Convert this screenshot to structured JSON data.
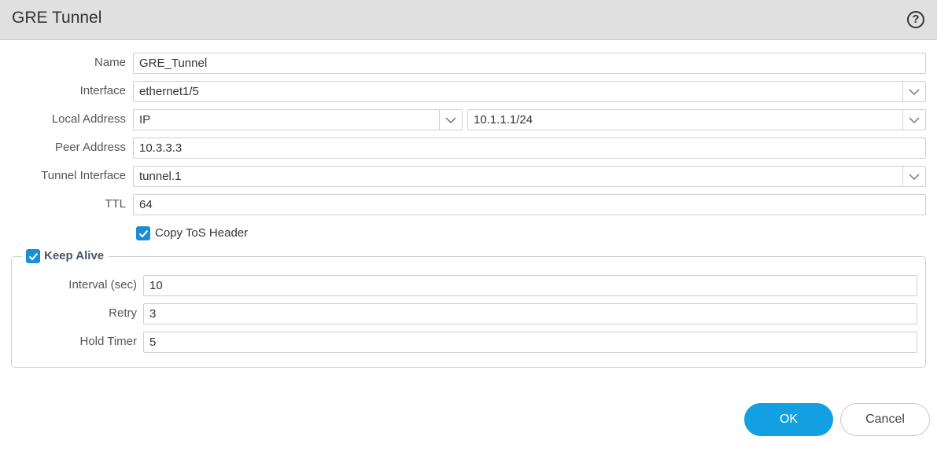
{
  "dialog": {
    "title": "GRE Tunnel",
    "help_icon": "question-circle-icon",
    "help_glyph": "?"
  },
  "form": {
    "name": {
      "label": "Name",
      "value": "GRE_Tunnel"
    },
    "interface": {
      "label": "Interface",
      "value": "ethernet1/5"
    },
    "local_address": {
      "label": "Local Address",
      "type_value": "IP",
      "ip_value": "10.1.1.1/24"
    },
    "peer_address": {
      "label": "Peer Address",
      "value": "10.3.3.3"
    },
    "tunnel_interface": {
      "label": "Tunnel Interface",
      "value": "tunnel.1"
    },
    "ttl": {
      "label": "TTL",
      "value": "64"
    },
    "copy_tos": {
      "label": "Copy ToS Header",
      "checked": true
    }
  },
  "keep_alive": {
    "label": "Keep Alive",
    "checked": true,
    "interval": {
      "label": "Interval (sec)",
      "value": "10"
    },
    "retry": {
      "label": "Retry",
      "value": "3"
    },
    "hold_timer": {
      "label": "Hold Timer",
      "value": "5"
    }
  },
  "buttons": {
    "ok": "OK",
    "cancel": "Cancel"
  },
  "colors": {
    "accent": "#12a0e2",
    "checkbox": "#1a8fd6",
    "header_bg": "#e0e0e0"
  }
}
